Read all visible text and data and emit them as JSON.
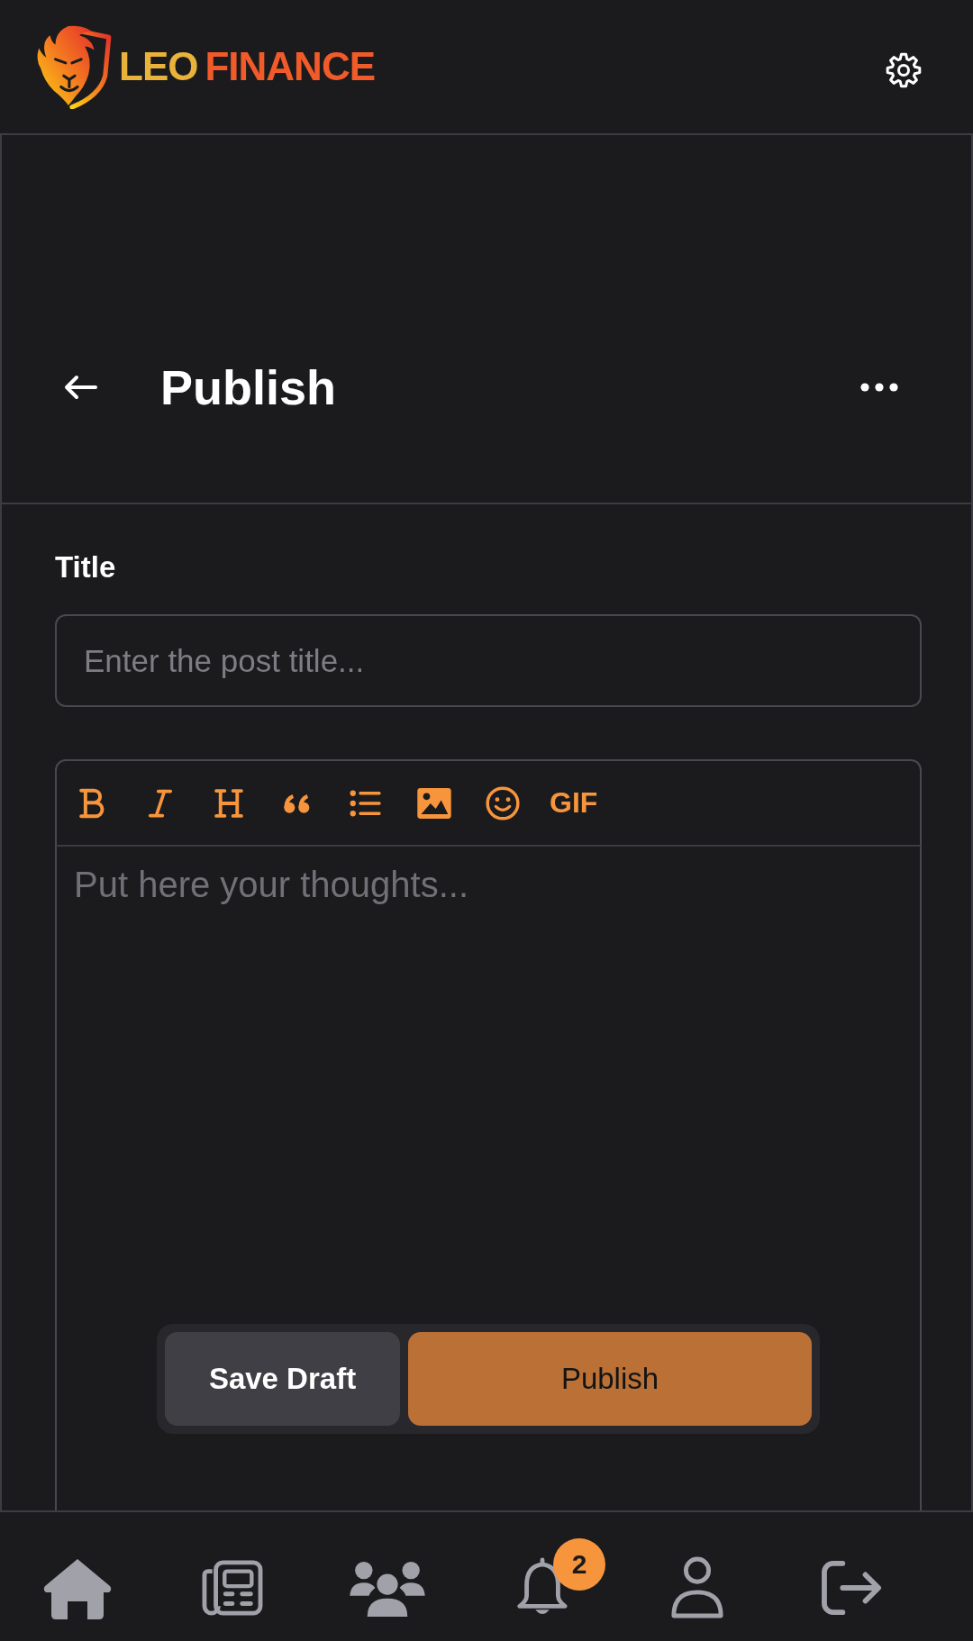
{
  "header": {
    "brand": [
      {
        "text": "LEO",
        "color": "#e9b23b"
      },
      {
        "text": "FINANCE",
        "color": "#f15a29"
      }
    ]
  },
  "page_header": {
    "title": "Publish"
  },
  "form": {
    "title_label": "Title",
    "title_field": {
      "placeholder": "Enter the post title..."
    },
    "editor": {
      "toolbar": [
        {
          "kind": "bold"
        },
        {
          "kind": "italic"
        },
        {
          "kind": "heading"
        },
        {
          "kind": "quote"
        },
        {
          "kind": "list"
        },
        {
          "kind": "image"
        },
        {
          "kind": "emoji"
        },
        {
          "kind": "gif",
          "label": "GIF"
        }
      ],
      "placeholder": "Put here your thoughts..."
    },
    "actions": [
      {
        "kind": "secondary",
        "label": "Save Draft"
      },
      {
        "kind": "primary",
        "label": "Publish"
      }
    ]
  },
  "bottom_nav": [
    {
      "kind": "home"
    },
    {
      "kind": "news"
    },
    {
      "kind": "community"
    },
    {
      "kind": "notifications",
      "badge": "2"
    },
    {
      "kind": "profile"
    },
    {
      "kind": "logout"
    }
  ]
}
